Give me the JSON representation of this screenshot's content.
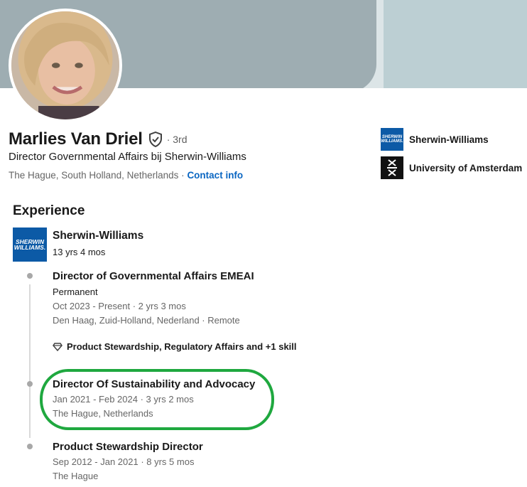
{
  "profile": {
    "name": "Marlies Van Driel",
    "degree": "· 3rd",
    "headline": "Director Governmental Affairs bij Sherwin-Williams",
    "location": "The Hague, South Holland, Netherlands",
    "separator": "·",
    "contact_link": "Contact info"
  },
  "orgs": [
    {
      "name": "Sherwin-Williams",
      "logo_text": "SHERWIN WILLIAMS."
    },
    {
      "name": "University of Amsterdam"
    }
  ],
  "experience": {
    "section_title": "Experience",
    "company": {
      "name": "Sherwin-Williams",
      "duration": "13 yrs 4 mos",
      "logo_text": "SHERWIN WILLIAMS."
    },
    "roles": [
      {
        "title": "Director of Governmental Affairs EMEAI",
        "employment_type": "Permanent",
        "dates": "Oct 2023 - Present · 2 yrs 3 mos",
        "location": "Den Haag, Zuid-Holland, Nederland · Remote",
        "skills": "Product Stewardship, Regulatory Affairs and +1 skill"
      },
      {
        "title": "Director Of Sustainability and Advocacy",
        "dates": "Jan 2021 - Feb 2024 · 3 yrs 2 mos",
        "location": "The Hague, Netherlands"
      },
      {
        "title": "Product Stewardship Director",
        "dates": "Sep 2012 - Jan 2021 · 8 yrs 5 mos",
        "location": "The Hague"
      }
    ]
  },
  "colors": {
    "link": "#0a66c2",
    "highlight": "#1fa83f",
    "brand_blue": "#0c5aa6"
  }
}
